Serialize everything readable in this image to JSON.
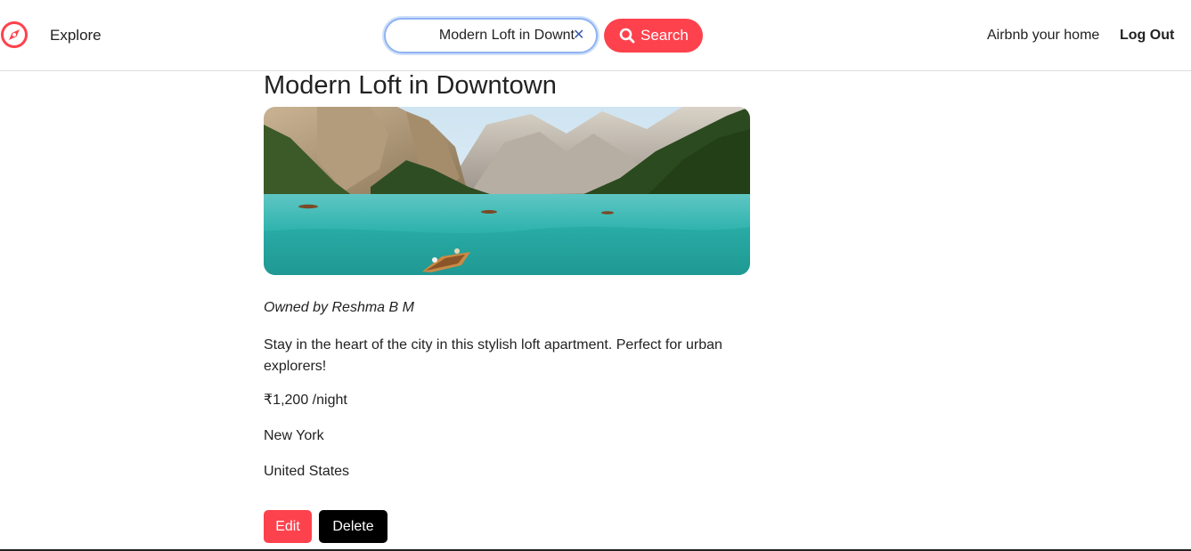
{
  "navbar": {
    "logo_icon": "compass-icon",
    "explore_label": "Explore",
    "search": {
      "value": "Modern Loft in Downt",
      "clear_icon": "close-icon",
      "button_label": "Search",
      "button_icon": "search-icon"
    },
    "host_label": "Airbnb your home",
    "logout_label": "Log Out"
  },
  "listing": {
    "title": "Modern Loft in Downtown",
    "image_alt": "Lake with boats surrounded by mountains",
    "owner": "Owned by Reshma B M",
    "description": "Stay in the heart of the city in this stylish loft apartment. Perfect for urban explorers!",
    "price": "₹1,200 /night",
    "location": "New York",
    "country": "United States"
  },
  "actions": {
    "edit_label": "Edit",
    "delete_label": "Delete"
  },
  "colors": {
    "brand": "#fe424d",
    "delete_bg": "#000000",
    "text": "#222222"
  }
}
